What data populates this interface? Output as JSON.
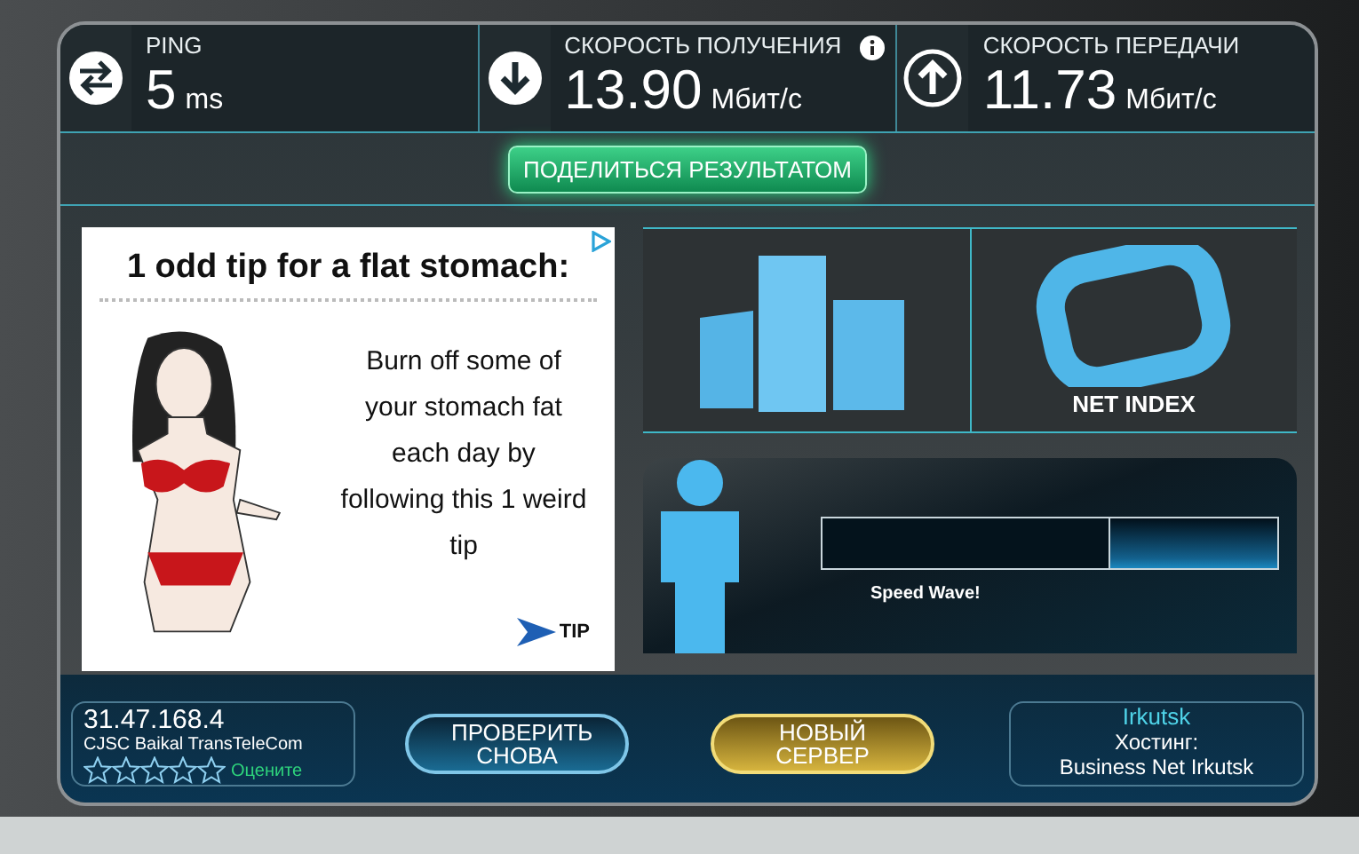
{
  "stats": [
    {
      "kind": "ping",
      "label": "PING",
      "value": "5",
      "unit": "ms",
      "info": false
    },
    {
      "kind": "download",
      "label": "СКОРОСТЬ ПОЛУЧЕНИЯ",
      "value": "13.90",
      "unit": "Мбит/с",
      "info": true
    },
    {
      "kind": "upload",
      "label": "СКОРОСТЬ ПЕРЕДАЧИ",
      "value": "11.73",
      "unit": "Мбит/с",
      "info": false
    }
  ],
  "share_button": "ПОДЕЛИТЬСЯ РЕЗУЛЬТАТОМ",
  "ad": {
    "headline": "1 odd tip for a flat stomach:",
    "body": "Burn off some of your stomach fat each day by following this 1 weird tip",
    "cta": "TIP"
  },
  "tiles": [
    {
      "kind": "chart"
    },
    {
      "kind": "net_index",
      "label": "NET INDEX"
    }
  ],
  "progress": {
    "level": 0.63,
    "caption": "Speed Wave!"
  },
  "isp": {
    "ip": "31.47.168.4",
    "name": "CJSC Baikal TransTeleCom",
    "stars": 0,
    "rate_label": "Оцените"
  },
  "buttons": [
    {
      "kind": "again",
      "label": "ПРОВЕРИТЬ СНОВА"
    },
    {
      "kind": "server",
      "label": "НОВЫЙ СЕРВЕР"
    }
  ],
  "server": {
    "city": "Irkutsk",
    "host_label": "Хостинг:",
    "host": "Business Net Irkutsk"
  }
}
